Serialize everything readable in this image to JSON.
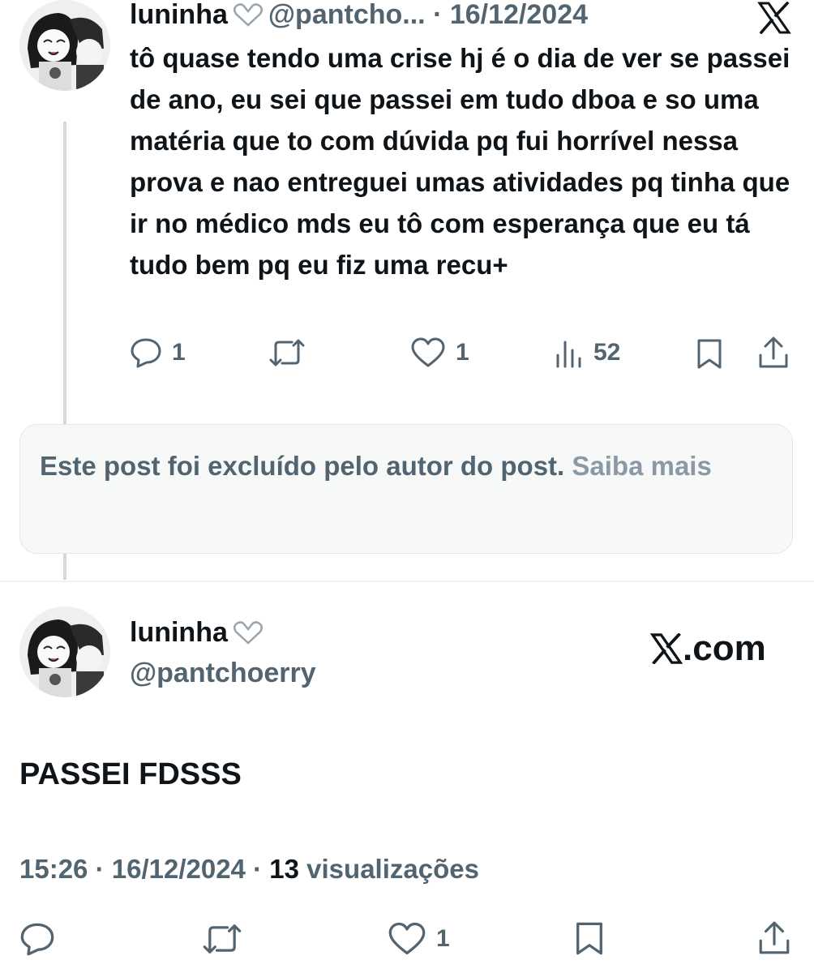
{
  "tweet1": {
    "display_name": "luninha",
    "handle": "@pantcho...",
    "separator": "·",
    "date": "16/12/2024",
    "text": "tô quase tendo uma crise hj é o dia de ver se passei de ano, eu sei que passei em tudo dboa e so uma matéria que to com dúvida pq fui horrível nessa prova e nao entreguei umas atividades pq tinha que ir no médico mds eu tô com esperança que eu tá tudo bem pq eu fiz uma recu+",
    "actions": {
      "reply_count": "1",
      "repost_count": "",
      "like_count": "1",
      "view_count": "52"
    }
  },
  "deleted_notice": {
    "text": "Este post foi excluído pelo autor do post.",
    "link": "Saiba mais"
  },
  "tweet2": {
    "display_name": "luninha",
    "handle": "@pantchoerry",
    "brand": ".com",
    "text": "PASSEI FDSSS",
    "time": "15:26",
    "separator": "·",
    "date": "16/12/2024",
    "view_count": "13",
    "view_label": "visualizações",
    "actions": {
      "like_count": "1"
    }
  },
  "icons": {
    "reply": "reply-icon",
    "repost": "repost-icon",
    "like": "heart-icon",
    "views": "views-icon",
    "bookmark": "bookmark-icon",
    "share": "share-icon",
    "x_logo": "x-logo-icon",
    "heart_hands": "heart-hands-emoji"
  },
  "colors": {
    "text_primary": "#0f1419",
    "text_secondary": "#536471",
    "thread_line": "#cfd9de",
    "deleted_bg": "#f7f9f9"
  }
}
